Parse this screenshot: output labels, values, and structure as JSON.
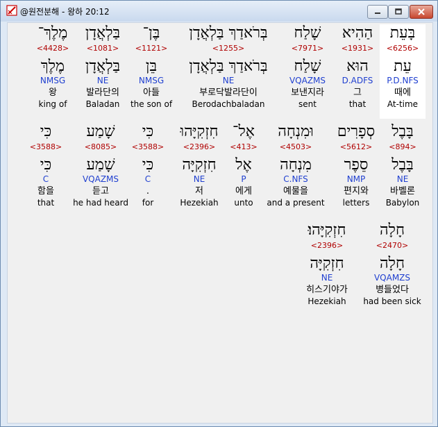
{
  "window": {
    "title": "@원전분해 - 왕하 20:12"
  },
  "rows": [
    [
      {
        "surface": "בָּעֵת",
        "strong": "<6256>",
        "lemma": "עֵת",
        "parse": "P.D.NFS",
        "korean": "때에",
        "english": "At-time",
        "highlight": true
      },
      {
        "surface": "הַהִיא",
        "strong": "<1931>",
        "lemma": "הוּא",
        "parse": "D.ADFS",
        "korean": "그",
        "english": "that"
      },
      {
        "surface": "שָׁלַח",
        "strong": "<7971>",
        "lemma": "שָׁלַח",
        "parse": "VQAZMS",
        "korean": "보낸지라",
        "english": "sent"
      },
      {
        "surface": "בְּרֹאדַךְ בַּלְאֲדָן",
        "strong": "<1255>",
        "lemma": "בְּרֹאדַךְ בַּלְאֲדָן",
        "parse": "NE",
        "korean": "부로닥발라단이",
        "english": "Berodachbaladan"
      },
      {
        "surface": "בֶּן־",
        "strong": "<1121>",
        "lemma": "בֵּן",
        "parse": "NMSG",
        "korean": "아들",
        "english": "the son of"
      },
      {
        "surface": "בַּלְאֲדָן",
        "strong": "<1081>",
        "lemma": "בַּלְאֲדָן",
        "parse": "NE",
        "korean": "발라단의",
        "english": "Baladan"
      },
      {
        "surface": "מֶלֶךְ־",
        "strong": "<4428>",
        "lemma": "מֶלֶךְ",
        "parse": "NMSG",
        "korean": "왕",
        "english": "king of"
      }
    ],
    [
      {
        "surface": "בָּבֶל",
        "strong": "<894>",
        "lemma": "בָּבֶל",
        "parse": "NE",
        "korean": "바벨론",
        "english": "Babylon"
      },
      {
        "surface": "סְפָרִים",
        "strong": "<5612>",
        "lemma": "סֵפֶר",
        "parse": "NMP",
        "korean": "편지와",
        "english": "letters"
      },
      {
        "surface": "וּמִנְחָה",
        "strong": "<4503>",
        "lemma": "מִנְחָה",
        "parse": "C.NFS",
        "korean": "예물을",
        "english": "and a present"
      },
      {
        "surface": "אֶל־",
        "strong": "<413>",
        "lemma": "אֶל",
        "parse": "P",
        "korean": "에게",
        "english": "unto"
      },
      {
        "surface": "חִזְקִיָּהוּ",
        "strong": "<2396>",
        "lemma": "חִזְקִיָּה",
        "parse": "NE",
        "korean": "저",
        "english": "Hezekiah"
      },
      {
        "surface": "כִּי",
        "strong": "<3588>",
        "lemma": "כִּי",
        "parse": "C",
        "korean": ".",
        "english": "for"
      },
      {
        "surface": "שָׁמַע",
        "strong": "<8085>",
        "lemma": "שָׁמַע",
        "parse": "VQAZMS",
        "korean": "듣고",
        "english": "he had heard"
      },
      {
        "surface": "כִּי",
        "strong": "<3588>",
        "lemma": "כִּי",
        "parse": "C",
        "korean": "함을",
        "english": "that"
      }
    ],
    [
      {
        "surface": "חָלָה",
        "strong": "<2470>",
        "lemma": "חָלָה",
        "parse": "VQAMZS",
        "korean": "병들었다",
        "english": "had been sick"
      },
      {
        "surface": "חִזְקִיָּהוּ׃",
        "strong": "<2396>",
        "lemma": "חִזְקִיָּה",
        "parse": "NE",
        "korean": "히스기야가",
        "english": "Hezekiah"
      }
    ]
  ]
}
